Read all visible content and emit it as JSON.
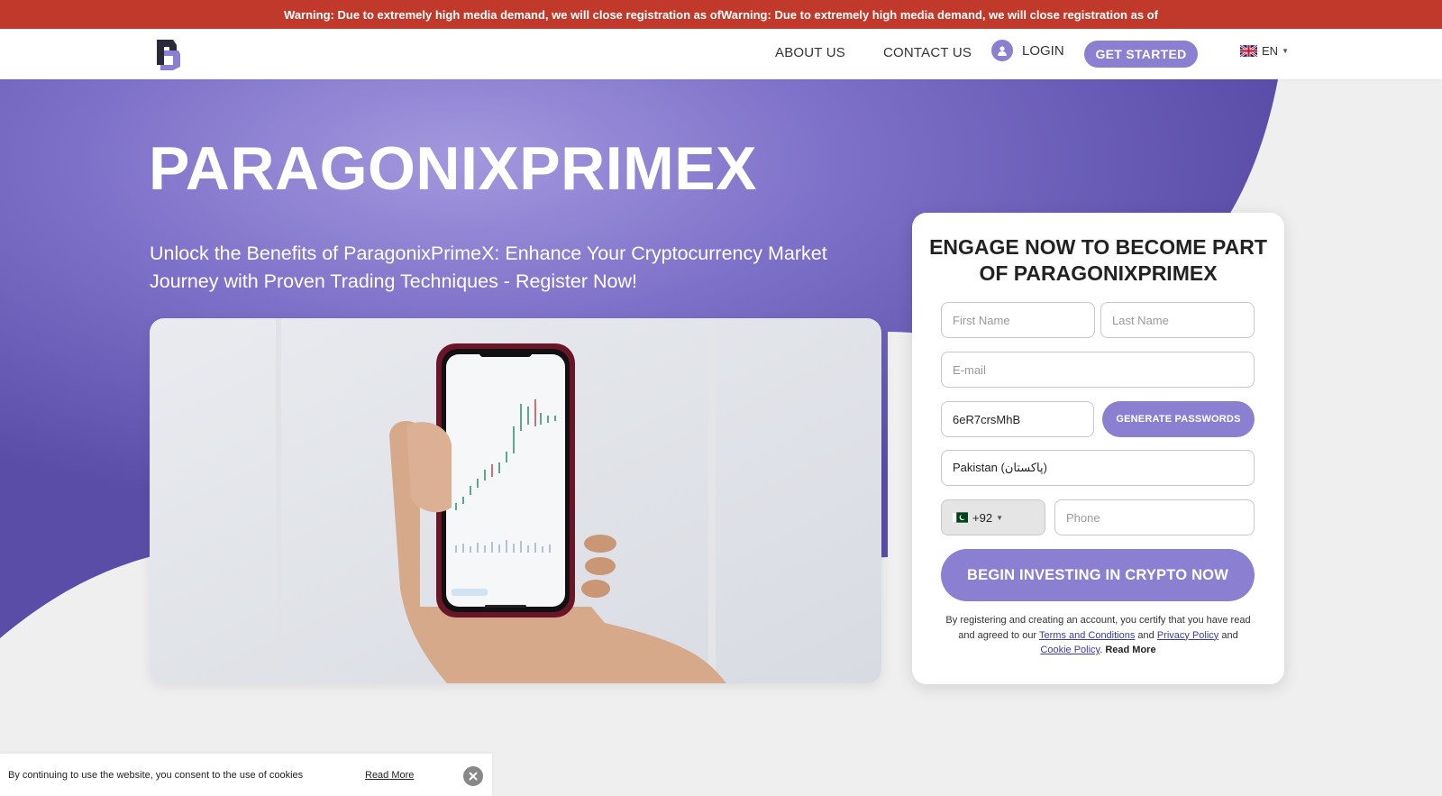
{
  "warning": {
    "text": "Warning: Due to extremely high media demand, we will close registration as ofWarning: Due to extremely high media demand, we will close registration as of"
  },
  "nav": {
    "about": "ABOUT US",
    "contact": "CONTACT US",
    "login": "LOGIN",
    "get_started": "GET STARTED",
    "language": "EN"
  },
  "hero": {
    "title": "PARAGONIXPRIMEX",
    "subtitle": "Unlock the Benefits of ParagonixPrimeX: Enhance Your Cryptocurrency Market Journey with Proven Trading Techniques - Register Now!"
  },
  "form": {
    "title": "ENGAGE NOW TO BECOME PART OF PARAGONIXPRIMEX",
    "first_name_placeholder": "First Name",
    "last_name_placeholder": "Last Name",
    "email_placeholder": "E-mail",
    "password_value": "6eR7crsMhB",
    "generate_label": "GENERATE PASSWORDS",
    "country_value": "Pakistan (پاکستان)",
    "dial_code": "+92",
    "phone_placeholder": "Phone",
    "submit_label": "BEGIN INVESTING IN CRYPTO NOW",
    "legal_prefix": "By registering and creating an account, you certify that you have read and agreed to our",
    "terms_link": "Terms and Conditions",
    "and_1": "and",
    "privacy_link": "Privacy Policy",
    "and_2": "and",
    "cookie_link": "Cookie Policy",
    "period": ".",
    "read_more": "Read More"
  },
  "cookie": {
    "text": "By continuing to use the website, you consent to the use of cookies",
    "read_more": "Read More"
  },
  "colors": {
    "accent": "#8b7fd1",
    "hero_purple": "#6a5db8",
    "warning_red": "#c0392b"
  }
}
